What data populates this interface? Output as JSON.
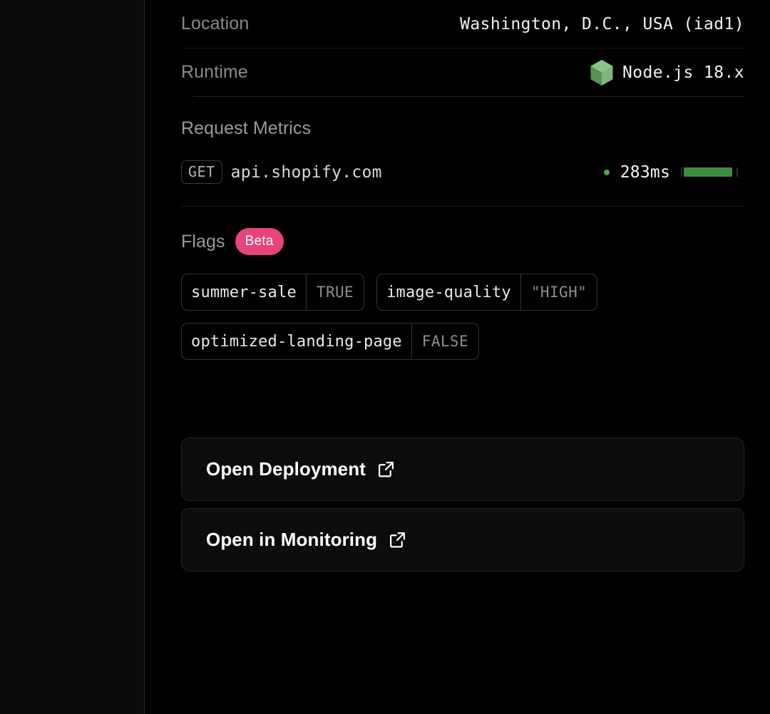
{
  "theme": {
    "page_bg": "#000000",
    "side_bg": "#0a0a0a",
    "accent_pink": "#e7437c",
    "accent_green": "#3f8a41",
    "status_green": "#4ea64e"
  },
  "details": {
    "rows": [
      {
        "label": "Location",
        "value": "Washington, D.C., USA (iad1)"
      },
      {
        "label": "Runtime",
        "value": "Node.js 18.x",
        "icon": "nodejs-hexagon-icon"
      }
    ]
  },
  "request_metrics": {
    "title": "Request Metrics",
    "entries": [
      {
        "method": "GET",
        "host": "api.shopify.com",
        "duration": "283ms",
        "status": "healthy",
        "bar_fill_percent": 95
      }
    ]
  },
  "flags": {
    "title": "Flags",
    "badge": "Beta",
    "items": [
      {
        "name": "summer-sale",
        "value": "TRUE"
      },
      {
        "name": "image-quality",
        "value": "\"HIGH\""
      },
      {
        "name": "optimized-landing-page",
        "value": "FALSE"
      }
    ]
  },
  "actions": [
    {
      "label": "Open Deployment",
      "icon": "external-link-icon"
    },
    {
      "label": "Open in Monitoring",
      "icon": "external-link-icon"
    }
  ]
}
